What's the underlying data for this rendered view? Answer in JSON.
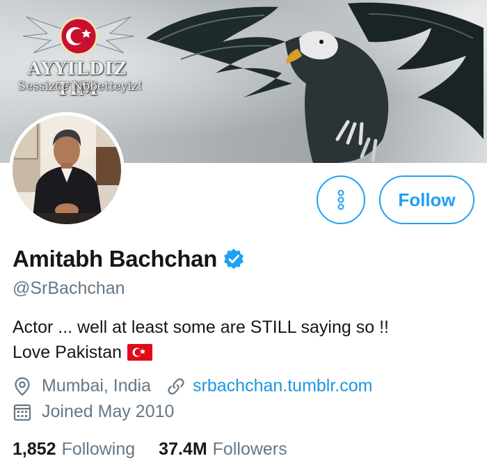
{
  "banner": {
    "logo_text": "AYYILDIZ TIM",
    "tagline": "Sessizce Nöbetteyiz!"
  },
  "profile": {
    "name": "Amitabh Bachchan",
    "verified": true,
    "handle": "@SrBachchan",
    "bio_lines": [
      "Actor ... well at least some are STILL saying so !!",
      "Love Pakistan"
    ],
    "bio_flag_icon": "turkey-flag-icon",
    "location": "Mumbai, India",
    "website": "srbachchan.tumblr.com",
    "joined": "Joined May 2010"
  },
  "actions": {
    "more_icon": "more-vertical-icon",
    "follow_label": "Follow"
  },
  "stats": {
    "following_count": "1,852",
    "following_label": "Following",
    "followers_count": "37.4M",
    "followers_label": "Followers"
  },
  "colors": {
    "accent": "#1da1f2",
    "link": "#1b95e0",
    "secondary_text": "#657786",
    "primary_text": "#14171a",
    "flag_red": "#e30a17"
  }
}
